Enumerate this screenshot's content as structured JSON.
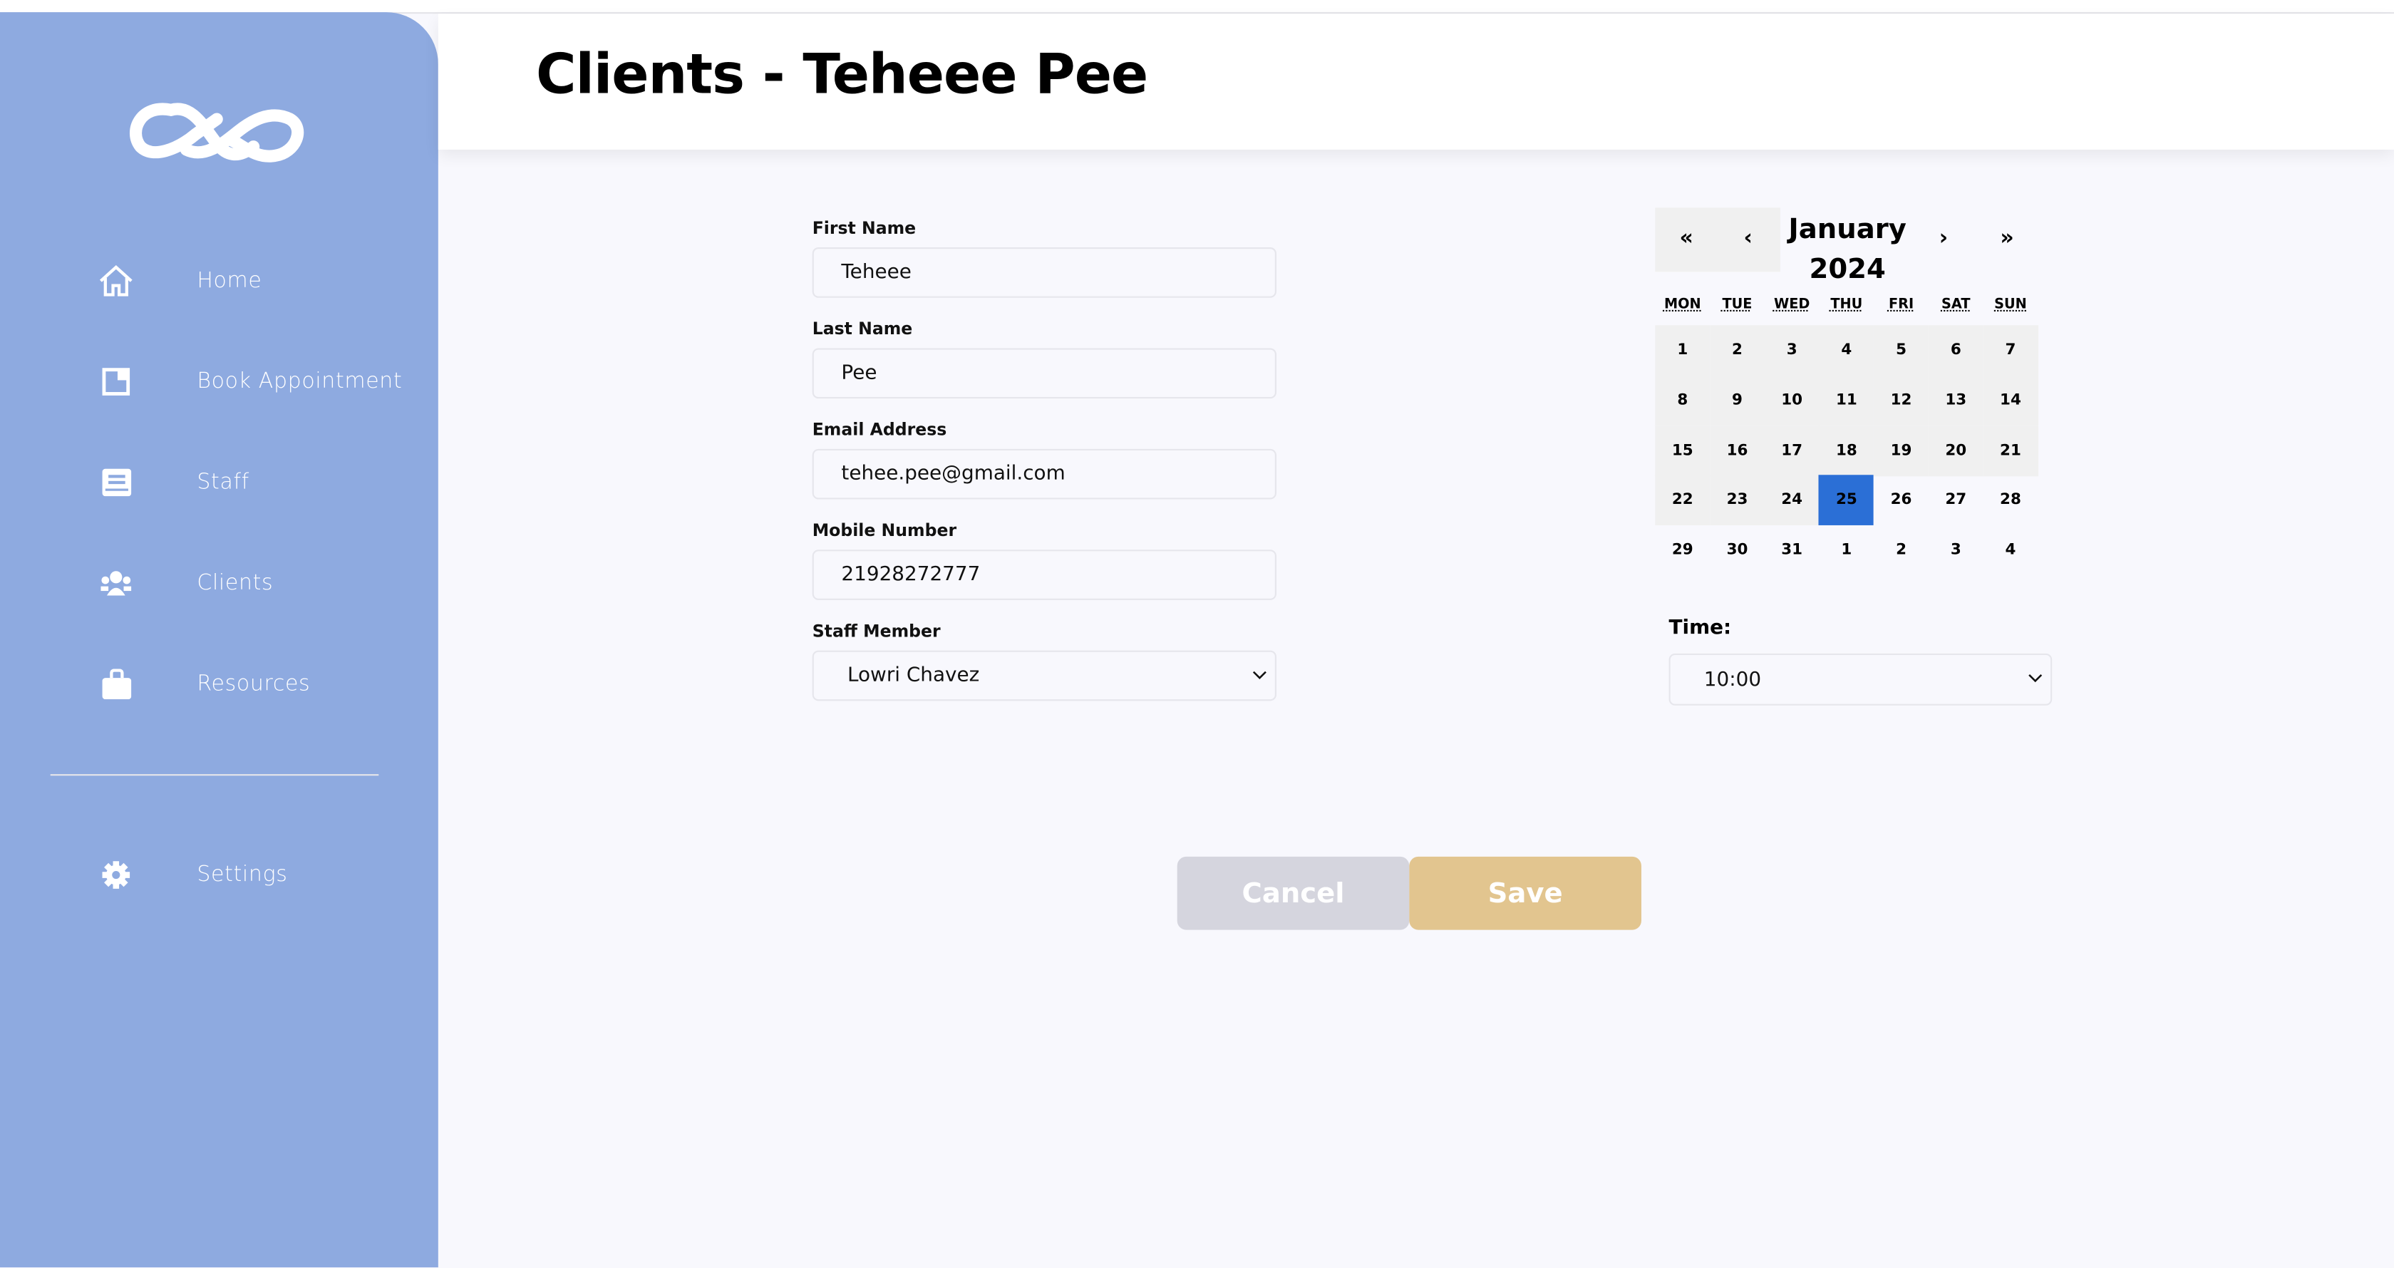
{
  "sidebar": {
    "items": [
      {
        "label": "Home",
        "icon": "home-icon"
      },
      {
        "label": "Book Appointment",
        "icon": "book-icon"
      },
      {
        "label": "Staff",
        "icon": "id-card-icon"
      },
      {
        "label": "Clients",
        "icon": "users-icon"
      },
      {
        "label": "Resources",
        "icon": "briefcase-icon"
      }
    ],
    "settings": {
      "label": "Settings",
      "icon": "gear-icon"
    }
  },
  "header": {
    "title": "Clients - Teheee Pee"
  },
  "form": {
    "first_name": {
      "label": "First Name",
      "value": "Teheee"
    },
    "last_name": {
      "label": "Last Name",
      "value": "Pee"
    },
    "email": {
      "label": "Email Address",
      "value": "tehee.pee@gmail.com"
    },
    "mobile": {
      "label": "Mobile Number",
      "value": "21928272777"
    },
    "staff": {
      "label": "Staff Member",
      "value": "Lowri Chavez"
    }
  },
  "calendar": {
    "nav": {
      "prev_year": "«",
      "prev": "‹",
      "next": "›",
      "next_year": "»"
    },
    "month": "January",
    "year": "2024",
    "weekdays": [
      "MON",
      "TUE",
      "WED",
      "THU",
      "FRI",
      "SAT",
      "SUN"
    ],
    "days": [
      "1",
      "2",
      "3",
      "4",
      "5",
      "6",
      "7",
      "8",
      "9",
      "10",
      "11",
      "12",
      "13",
      "14",
      "15",
      "16",
      "17",
      "18",
      "19",
      "20",
      "21",
      "22",
      "23",
      "24",
      "25",
      "26",
      "27",
      "28",
      "29",
      "30",
      "31",
      "1",
      "2",
      "3",
      "4"
    ],
    "selected_index": 24,
    "past_count": 24,
    "selected_color": "#2b6fd6"
  },
  "time": {
    "label": "Time:",
    "value": "10:00"
  },
  "actions": {
    "cancel": "Cancel",
    "save": "Save",
    "cancel_color": "#d5d5de",
    "save_color": "#e2c58f"
  },
  "colors": {
    "sidebar": "#8eaae0"
  }
}
